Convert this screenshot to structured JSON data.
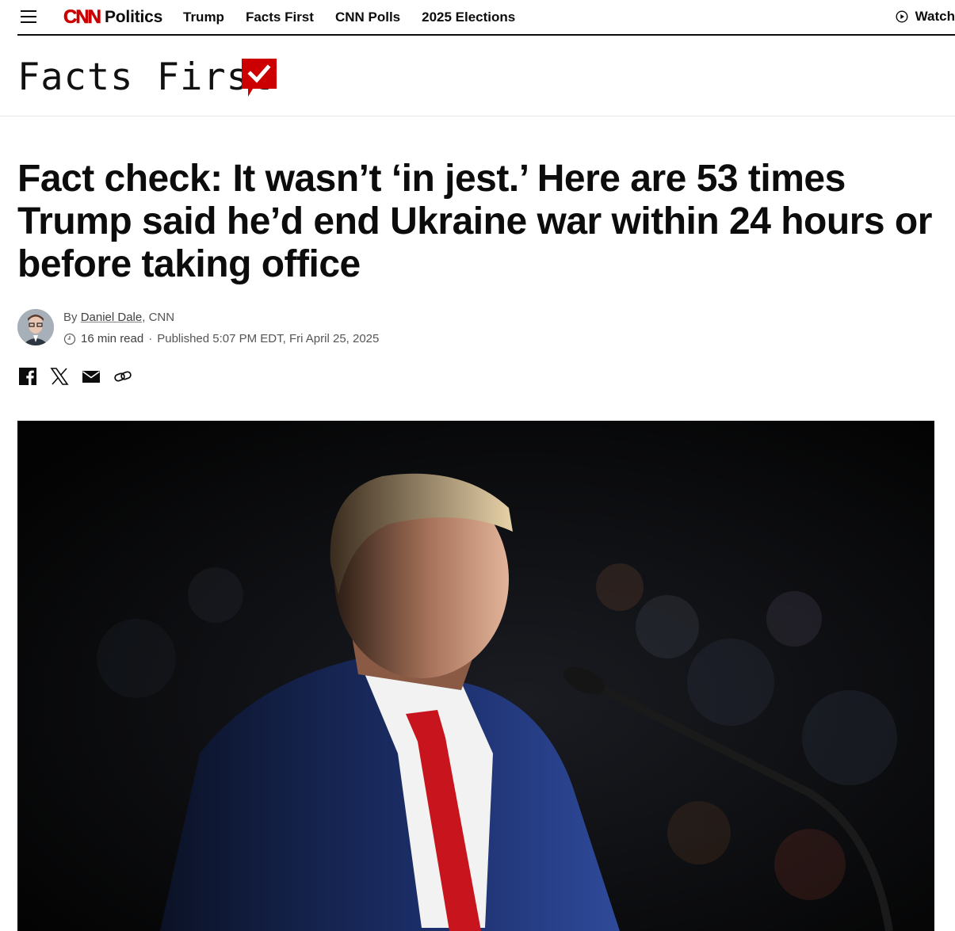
{
  "nav": {
    "menu_icon": "hamburger-menu-icon",
    "logo_text": "CNN",
    "section": "Politics",
    "links": [
      "Trump",
      "Facts First",
      "CNN Polls",
      "2025 Elections"
    ],
    "watch_label": "Watch",
    "brand_color": "#cc0000"
  },
  "banner": {
    "title": "Facts First",
    "check_color": "#cc0000"
  },
  "article": {
    "headline": "Fact check: It wasn’t ‘in jest.’ Here are 53 times Trump said he’d end Ukraine war within 24 hours or before taking office",
    "by_prefix": "By",
    "author": "Daniel Dale",
    "outlet": ", CNN",
    "read_time": "16 min read",
    "separator": "·",
    "published": "Published 5:07 PM EDT, Fri April 25, 2025"
  },
  "share": {
    "icons": [
      "facebook-icon",
      "x-icon",
      "email-icon",
      "link-icon"
    ]
  },
  "hero_image": {
    "description_icon": "photo"
  }
}
